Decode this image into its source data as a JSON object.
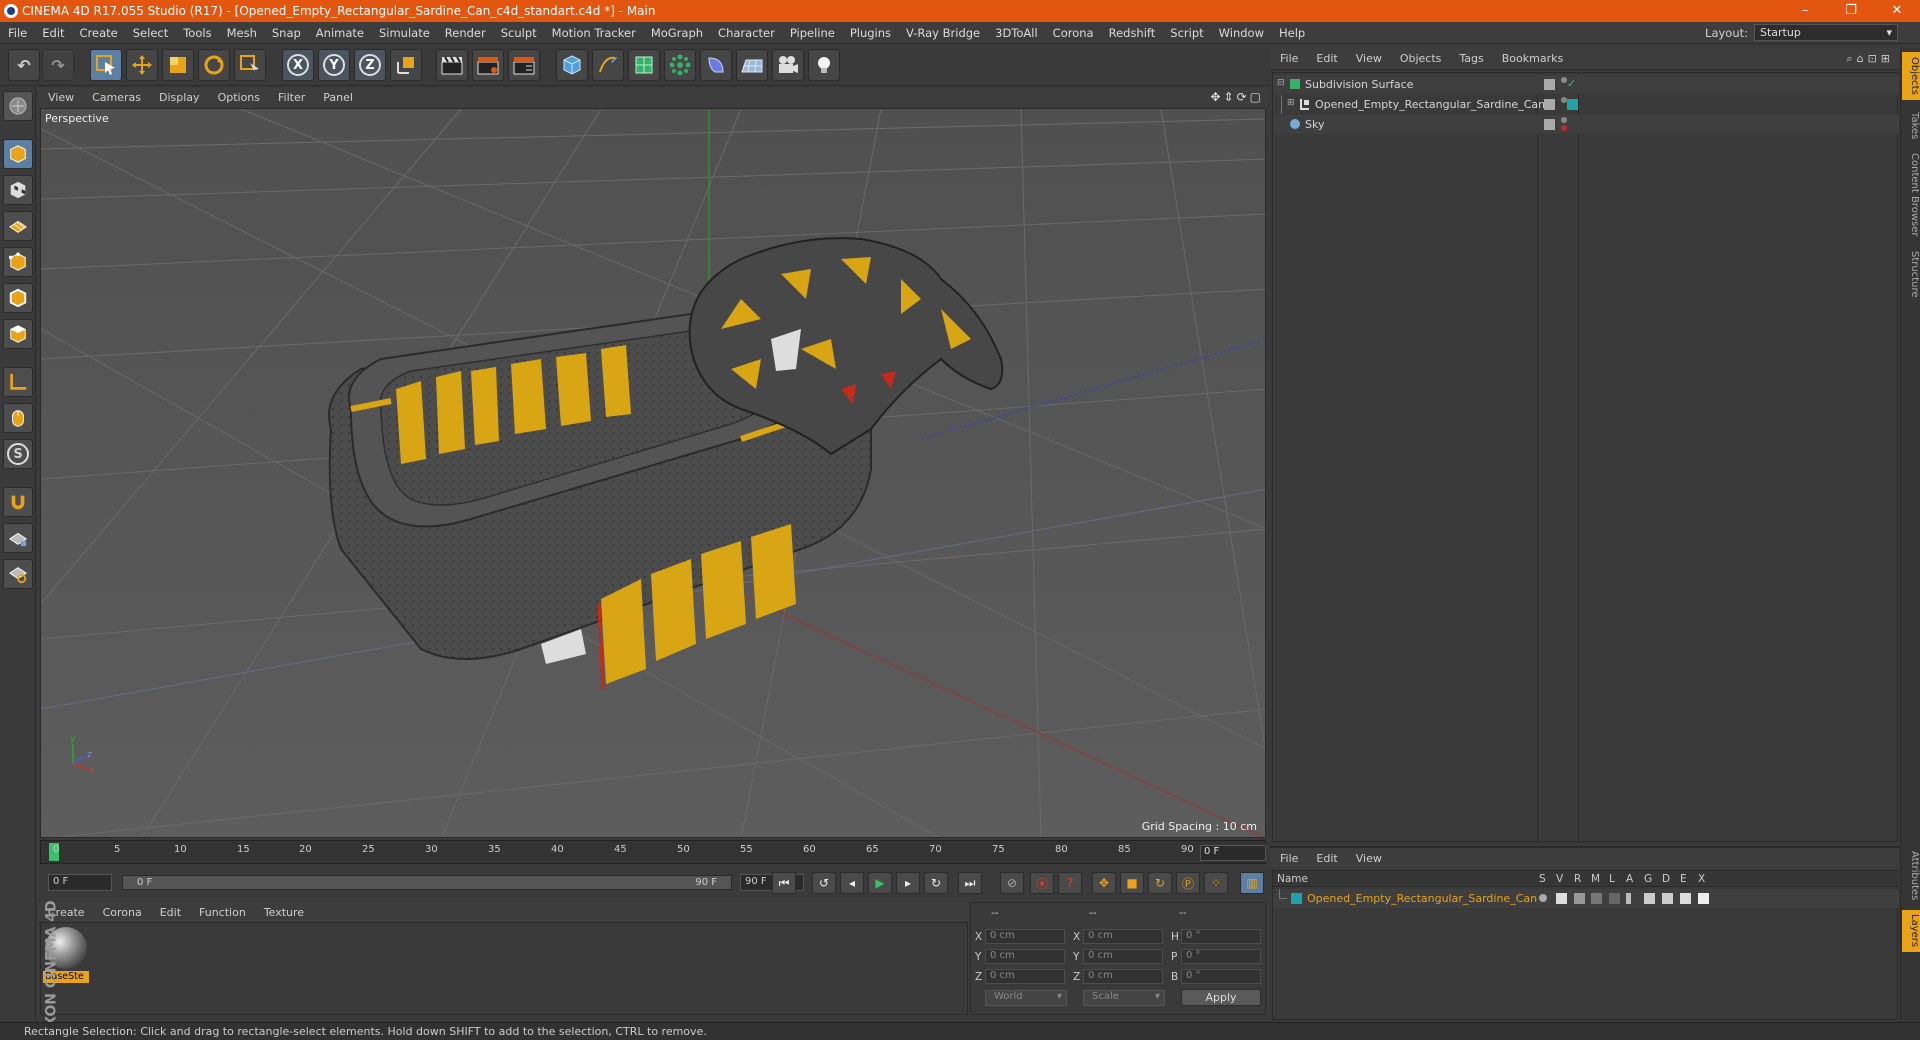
{
  "window": {
    "title": "CINEMA 4D R17.055 Studio (R17) - [Opened_Empty_Rectangular_Sardine_Can_c4d_standart.c4d *] - Main",
    "buttons": [
      "–",
      "❐",
      "✕"
    ]
  },
  "menubar": {
    "items": [
      "File",
      "Edit",
      "Create",
      "Select",
      "Tools",
      "Mesh",
      "Snap",
      "Animate",
      "Simulate",
      "Render",
      "Sculpt",
      "Motion Tracker",
      "MoGraph",
      "Character",
      "Pipeline",
      "Plugins",
      "V-Ray Bridge",
      "3DToAll",
      "Corona",
      "Redshift",
      "Script",
      "Window",
      "Help"
    ],
    "layout_label": "Layout:",
    "layout_value": "Startup"
  },
  "toolbar": {
    "undo": "↶",
    "redo": "↷",
    "axis_x": "X",
    "axis_y": "Y",
    "axis_z": "Z"
  },
  "leftbar": {
    "snap_label": "S"
  },
  "viewport": {
    "menu": [
      "View",
      "Cameras",
      "Display",
      "Options",
      "Filter",
      "Panel"
    ],
    "nav_icons": "✥⇕⟳▢",
    "camera_label": "Perspective",
    "grid_spacing": "Grid Spacing : 10 cm",
    "axis_labels": {
      "y": "y",
      "z": "z",
      "x": "x"
    }
  },
  "timeline": {
    "ticks": [
      "0",
      "5",
      "10",
      "15",
      "20",
      "25",
      "30",
      "35",
      "40",
      "45",
      "50",
      "55",
      "60",
      "65",
      "70",
      "75",
      "80",
      "85",
      "90"
    ],
    "current_frame": "0 F",
    "start_field": "0 F",
    "range_start": "0 F",
    "range_end": "90 F",
    "end_field": "90 F"
  },
  "materials": {
    "menu": [
      "Create",
      "Corona",
      "Edit",
      "Function",
      "Texture"
    ],
    "items": [
      {
        "name": "BaseSte"
      }
    ]
  },
  "branding": "MAXON CINEMA 4D",
  "coordinates": {
    "headers": [
      "--",
      "--",
      "--"
    ],
    "rows": [
      {
        "l1": "X",
        "v1": "0 cm",
        "l2": "X",
        "v2": "0 cm",
        "l3": "H",
        "v3": "0 °"
      },
      {
        "l1": "Y",
        "v1": "0 cm",
        "l2": "Y",
        "v2": "0 cm",
        "l3": "P",
        "v3": "0 °"
      },
      {
        "l1": "Z",
        "v1": "0 cm",
        "l2": "Z",
        "v2": "0 cm",
        "l3": "B",
        "v3": "0 °"
      }
    ],
    "mode1": "World",
    "mode2": "Scale",
    "apply": "Apply"
  },
  "objects": {
    "menu": [
      "File",
      "Edit",
      "View",
      "Objects",
      "Tags",
      "Bookmarks"
    ],
    "tools": "⌕⌂⊡⊞",
    "items": [
      {
        "name": "Subdivision Surface",
        "indent": 0
      },
      {
        "name": "Opened_Empty_Rectangular_Sardine_Can",
        "indent": 1
      },
      {
        "name": "Sky",
        "indent": 0
      }
    ],
    "check": "✓"
  },
  "layers": {
    "menu": [
      "File",
      "Edit",
      "View"
    ],
    "columns": [
      "Name",
      "S",
      "V",
      "R",
      "M",
      "L",
      "A",
      "G",
      "D",
      "E",
      "X"
    ],
    "items": [
      {
        "name": "Opened_Empty_Rectangular_Sardine_Can"
      }
    ]
  },
  "right_tabs": [
    "Objects",
    "Takes",
    "Content Browser",
    "Structure",
    "Attributes",
    "Layers"
  ],
  "status": "Rectangle Selection: Click and drag to rectangle-select elements. Hold down SHIFT to add to the selection, CTRL to remove.",
  "colors": {
    "titlebar": "#e2560f",
    "accent": "#e8a319",
    "layer_teal": "#1fa3a8"
  }
}
